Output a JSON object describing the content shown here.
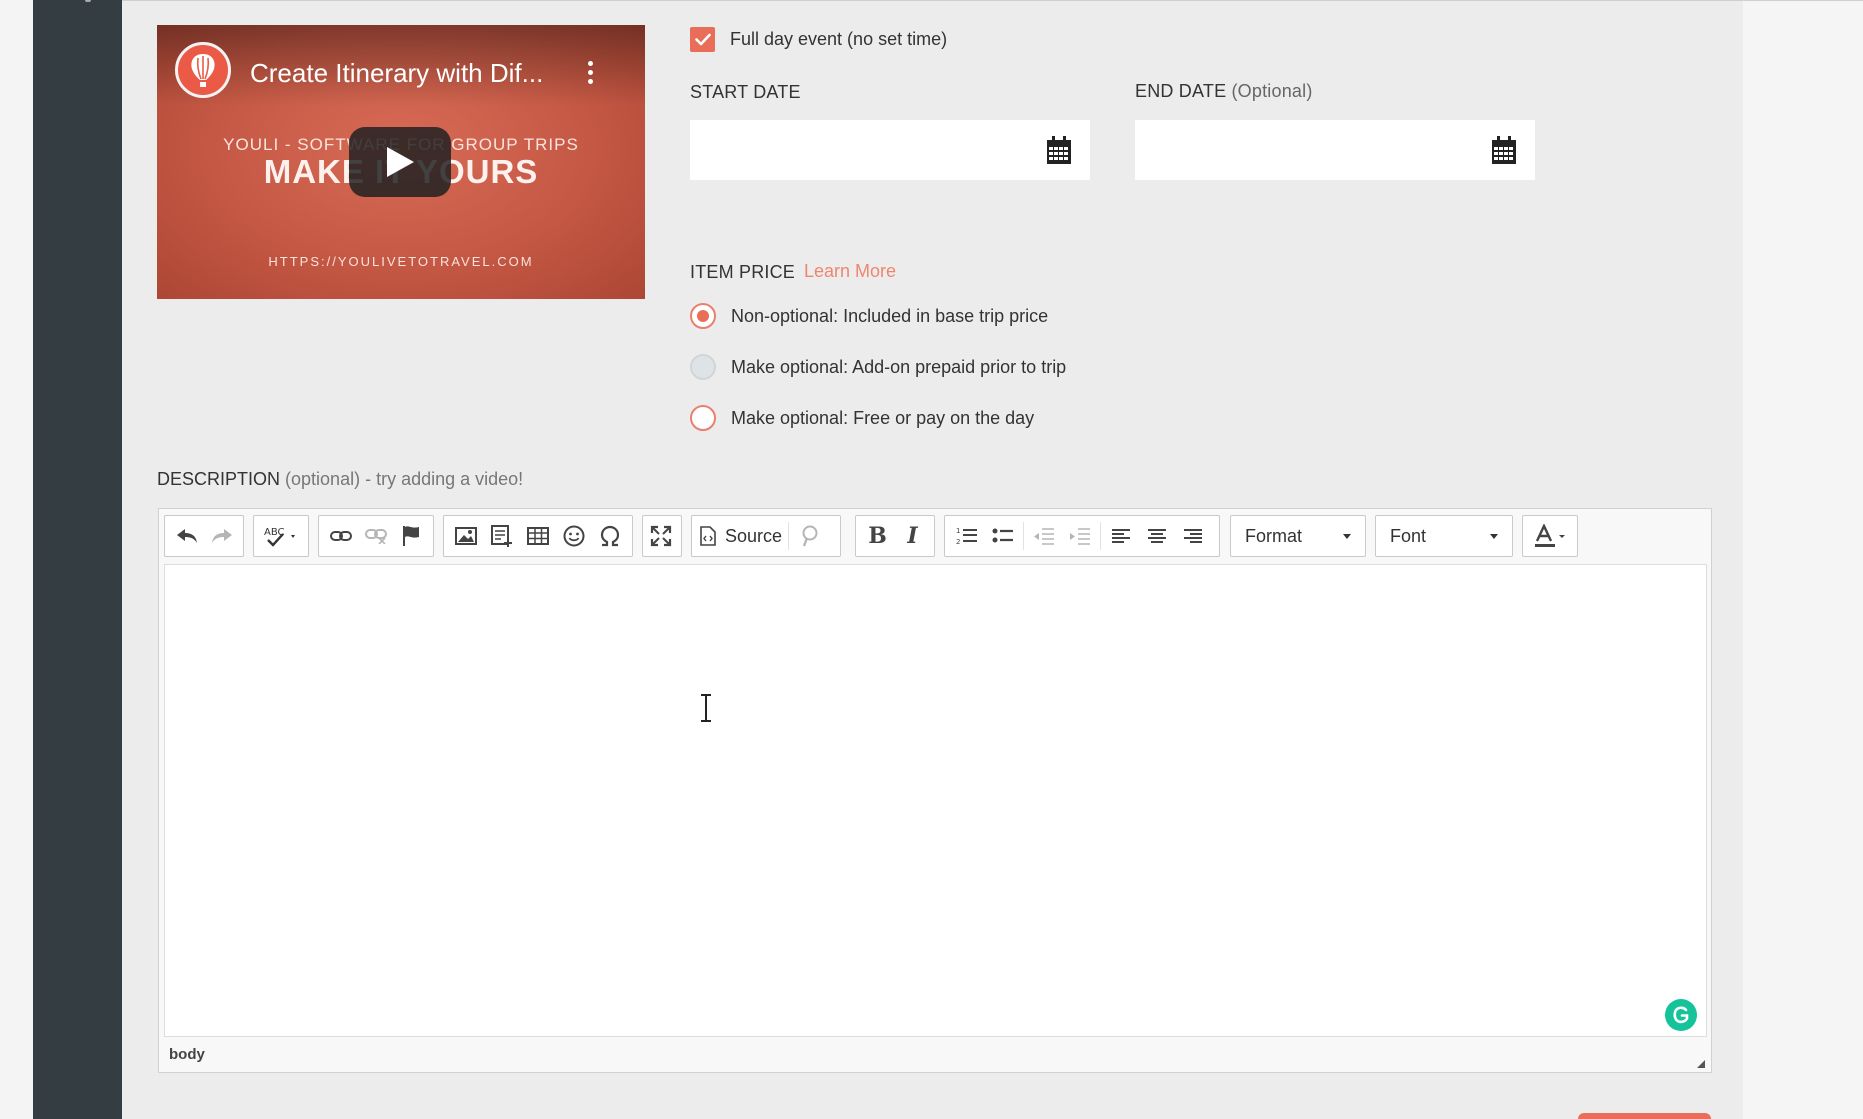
{
  "video": {
    "title": "Create Itinerary with Dif...",
    "subtitle": "YOULI - SOFTWARE FOR GROUP TRIPS",
    "headline": "MAKE IT YOURS",
    "url": "HTTPS://YOULIVETOTRAVEL.COM"
  },
  "form": {
    "full_day_label": "Full day event (no set time)",
    "full_day_checked": true,
    "start_date_label": "START DATE",
    "end_date_label": "END DATE",
    "end_date_optional": "(Optional)",
    "start_date_value": "",
    "end_date_value": "",
    "item_price_label": "ITEM PRICE",
    "learn_more": "Learn More",
    "price_options": [
      {
        "label": "Non-optional: Included in base trip price",
        "selected": true,
        "disabled": false
      },
      {
        "label": "Make optional: Add-on prepaid prior to trip",
        "selected": false,
        "disabled": true
      },
      {
        "label": "Make optional: Free or pay on the day",
        "selected": false,
        "disabled": false
      }
    ]
  },
  "description": {
    "label": "DESCRIPTION",
    "hint": "(optional) - try adding a video!"
  },
  "editor": {
    "source_label": "Source",
    "format_label": "Format",
    "font_label": "Font",
    "element_path": "body"
  },
  "colors": {
    "accent": "#e86e5a",
    "sidebar": "#343d42",
    "link": "#f0866f"
  }
}
